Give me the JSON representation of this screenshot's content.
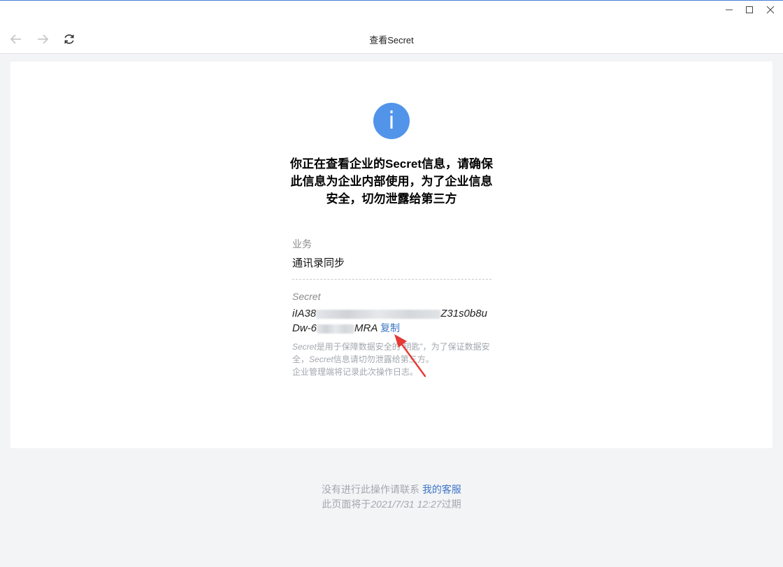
{
  "window": {
    "title": "查看Secret",
    "controls": [
      "minimize-icon",
      "maximize-icon",
      "close-icon"
    ]
  },
  "nav": {
    "icons": [
      "back-arrow-icon",
      "forward-arrow-icon",
      "refresh-icon"
    ]
  },
  "colors": {
    "accent": "#5294ea",
    "link": "#3e76c5",
    "muted": "#a2a7ae"
  },
  "content": {
    "info_icon_glyph": "i",
    "headline": "你正在查看企业的Secret信息，请确保此信息为企业内部使用，为了企业信息安全，切勿泄露给第三方",
    "business_label": "业务",
    "business_value": "通讯录同步",
    "secret_label": "Secret",
    "secret_line1_start": "iIA38",
    "secret_line1_end": "Z31s0b8u",
    "secret_line2_start": "Dw-6",
    "secret_line2_end": "MRA",
    "copy_label": "复制",
    "note_part1": "Secret",
    "note_part2": "是用于保障数据安全的“钥匙”，为了保证数据安全，",
    "note_part3": "Secret",
    "note_part4": "信息请切勿泄露给第三方。",
    "note_line3": "企业管理端将记录此次操作日志。"
  },
  "footer": {
    "contact_text": "没有进行此操作请联系",
    "contact_link": "我的客服",
    "expire_prefix": "此页面将于",
    "expire_date": "2021/7/31 12:27",
    "expire_suffix": "过期"
  }
}
